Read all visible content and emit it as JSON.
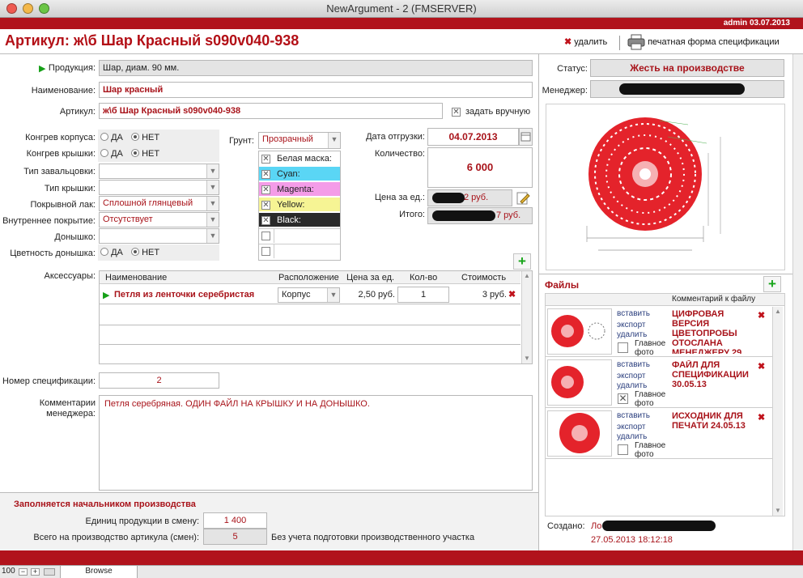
{
  "window": {
    "title": "NewArgument - 2 (FMSERVER)"
  },
  "header": {
    "user": "admin 03.07.2013",
    "title": "Артикул: ж\\б Шар Красный s090v040-938",
    "delete_label": "удалить",
    "print_label": "печатная форма спецификации"
  },
  "form": {
    "product_label": "Продукция:",
    "product_value": "Шар, диам. 90 мм.",
    "name_label": "Наименование:",
    "name_value": "Шар красный",
    "article_label": "Артикул:",
    "article_value": "ж\\б Шар Красный s090v040-938",
    "manual_label": "задать вручную",
    "congreve_body_label": "Конгрев корпуса:",
    "congreve_lid_label": "Конгрев крышки:",
    "yes": "ДА",
    "no": "НЕТ",
    "rolling_label": "Тип завальцовки:",
    "lid_type_label": "Тип крышки:",
    "varnish_label": "Покрывной лак:",
    "varnish_value": "Сплошной глянцевый",
    "inner_label": "Внутреннее покрытие:",
    "inner_value": "Отсутствует",
    "bottom_label": "Донышко:",
    "bottom_color_label": "Цветность донышка:",
    "primer_label": "Грунт:",
    "primer_value": "Прозрачный",
    "colors": [
      {
        "name": "Белая маска:",
        "bg": "#ffffff",
        "fg": "#222222"
      },
      {
        "name": "Cyan:",
        "bg": "#5ad6f5",
        "fg": "#222222"
      },
      {
        "name": "Magenta:",
        "bg": "#f49ce8",
        "fg": "#222222"
      },
      {
        "name": "Yellow:",
        "bg": "#f6f494",
        "fg": "#222222"
      },
      {
        "name": "Black:",
        "bg": "#2a2a2a",
        "fg": "#ffffff"
      }
    ],
    "ship_date_label": "Дата отгрузки:",
    "ship_date_value": "04.07.2013",
    "qty_label": "Количество:",
    "qty_value": "6 000",
    "unit_price_label": "Цена за ед.:",
    "unit_price_value": "2 руб.",
    "total_label": "Итого:",
    "total_value": "7 руб.",
    "status_label": "Статус:",
    "status_value": "Жесть на производстве",
    "manager_label": "Менеджер:"
  },
  "accessories": {
    "label": "Аксессуары:",
    "columns": [
      "Наименование",
      "Расположение",
      "Цена за ед.",
      "Кол-во",
      "Стоимость"
    ],
    "rows": [
      {
        "name": "Петля из ленточки серебристая",
        "place": "Корпус",
        "price": "2,50 руб.",
        "qty": "1",
        "cost": "3 руб."
      }
    ]
  },
  "spec": {
    "label": "Номер спецификации:",
    "value": "2"
  },
  "comments": {
    "label": "Комментарии менеджера:",
    "value": "Петля серебряная. ОДИН ФАЙЛ НА КРЫШКУ И НА ДОНЫШКО."
  },
  "production": {
    "title": "Заполняется начальником производства",
    "per_shift_label": "Единиц продукции в смену:",
    "per_shift_value": "1 400",
    "total_shifts_label": "Всего на производство артикула (смен):",
    "total_shifts_value": "5",
    "note": "Без учета подготовки производственного участка"
  },
  "files": {
    "title": "Файлы",
    "comment_header": "Комментарий к файлу",
    "insert": "вставить",
    "export": "экспорт",
    "delete": "удалить",
    "main_photo": "Главное фото",
    "items": [
      {
        "comment": "ЦИФРОВАЯ ВЕРСИЯ ЦВЕТОПРОБЫ ОТОСЛАНА МЕНЕДЖЕРУ 29",
        "main": false
      },
      {
        "comment": "ФАЙЛ ДЛЯ СПЕЦИФИКАЦИИ 30.05.13",
        "main": true
      },
      {
        "comment": "ИСХОДНИК ДЛЯ ПЕЧАТИ 24.05.13",
        "main": false
      }
    ]
  },
  "created": {
    "label": "Создано:",
    "prefix": "Ло",
    "date": "27.05.2013 18:12:18"
  },
  "statusbar": {
    "zoom": "100",
    "mode": "Browse"
  },
  "colors": {
    "brand_red": "#b1131c",
    "text_red": "#a8131a",
    "green": "#15a418"
  }
}
